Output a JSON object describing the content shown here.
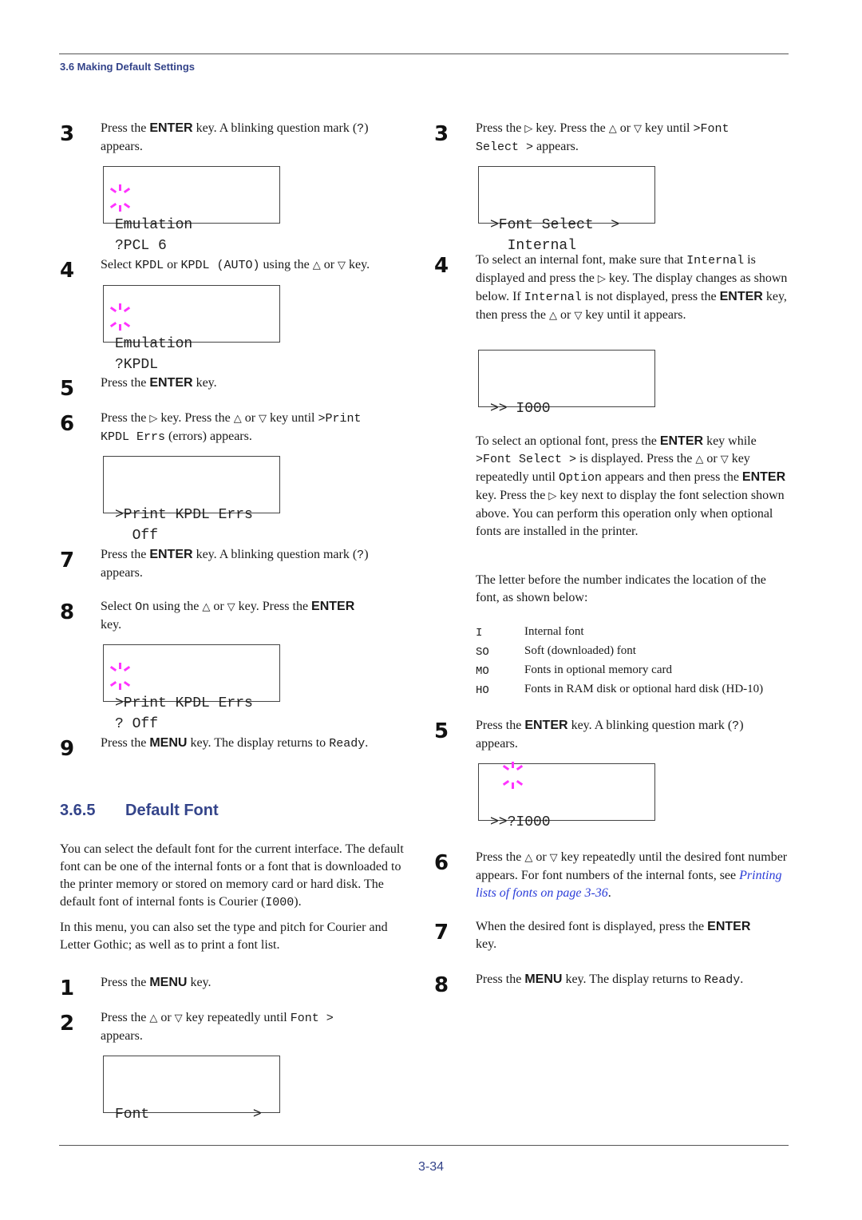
{
  "header": {
    "section_title": "3.6 Making Default Settings"
  },
  "footer": {
    "page_number": "3-34"
  },
  "left_column": {
    "steps_top": [
      {
        "number": "3",
        "parts": [
          "Press the ",
          "ENTER",
          " key. A blinking question mark (",
          "?",
          ")",
          " appears."
        ]
      },
      {
        "number": "4",
        "parts": [
          "Select ",
          "KPDL",
          " or ",
          "KPDL (AUTO)",
          " using the ",
          "△",
          " or ",
          "▽",
          " key."
        ]
      },
      {
        "number": "5",
        "parts": [
          "Press the ",
          "ENTER",
          " key."
        ]
      },
      {
        "number": "6",
        "parts": [
          "Press the ",
          "▷",
          " key. Press the ",
          "△",
          " or ",
          "▽",
          " key until ",
          ">Print",
          "KPDL Errs",
          " (errors) appears."
        ]
      },
      {
        "number": "7",
        "parts": [
          "Press the ",
          "ENTER",
          " key. A blinking question mark (",
          "?",
          ")",
          " appears."
        ]
      },
      {
        "number": "8",
        "parts": [
          "Select ",
          "On",
          " using the ",
          "△",
          " or ",
          "▽",
          " key. Press the ",
          "ENTER",
          " key."
        ]
      },
      {
        "number": "9",
        "parts": [
          "Press the ",
          "MENU",
          " key. The display returns to ",
          "Ready",
          "."
        ]
      }
    ],
    "displays": [
      {
        "line1": "Emulation",
        "line2": "?PCL 6",
        "blinking": true
      },
      {
        "line1": "Emulation",
        "line2": "?KPDL",
        "blinking": true
      },
      {
        "line1": ">Print KPDL Errs",
        "line2": "  Off",
        "blinking": false
      },
      {
        "line1": ">Print KPDL Errs",
        "line2": "? Off",
        "blinking": true
      }
    ],
    "section": {
      "number": "3.6.5",
      "title": "Default Font",
      "intro_1": [
        "You can select the default font for the current interface. The default font can be one of the internal fonts or a font that is downloaded to the printer memory or stored on memory card or hard disk. The default font of internal fonts is Courier (",
        "I000",
        ")."
      ],
      "intro_2": "In this menu, you can also set the type and pitch for Courier and Letter Gothic; as well as to print a font list.",
      "steps": [
        {
          "number": "1",
          "parts": [
            "Press the ",
            "MENU",
            " key."
          ]
        },
        {
          "number": "2",
          "parts": [
            "Press the ",
            "△",
            " or ",
            "▽",
            " key repeatedly until ",
            "Font >",
            " appears."
          ]
        }
      ],
      "display": {
        "line1": "Font            >",
        "line2": ""
      }
    }
  },
  "right_column": {
    "steps": [
      {
        "number": "3",
        "parts": [
          "Press the ",
          "▷",
          " key. Press the ",
          "△",
          " or ",
          "▽",
          " key until ",
          ">Font",
          "Select >",
          " appears."
        ]
      },
      {
        "number": "4",
        "parts": [
          "To select an internal font, make sure that ",
          "Internal",
          " is displayed and press the ",
          "▷",
          " key. The display changes as shown below. If ",
          "Internal",
          " is not displayed, press the ",
          "ENTER",
          " key, then press the ",
          "△",
          " or ",
          "▽",
          " key until it appears."
        ]
      },
      {
        "number": "5",
        "parts": [
          "Press the ",
          "ENTER",
          " key. A blinking question mark (",
          "?",
          ")",
          " appears."
        ]
      },
      {
        "number": "6",
        "parts": [
          "Press the ",
          "△",
          " or ",
          "▽",
          " key repeatedly until the desired font number appears. For font numbers of the internal fonts, see ",
          "Printing lists of fonts on page 3-36",
          "."
        ]
      },
      {
        "number": "7",
        "parts": [
          "When the desired font is displayed, press the ",
          "ENTER",
          " key."
        ]
      },
      {
        "number": "8",
        "parts": [
          "Press the ",
          "MENU",
          " key. The display returns to ",
          "Ready",
          "."
        ]
      }
    ],
    "displays": [
      {
        "line1": ">Font Select  >",
        "line2": "  Internal",
        "blinking": false
      },
      {
        "line1": ">> I000",
        "line2": "",
        "blinking": false
      },
      {
        "line1": ">>?I000",
        "line2": "",
        "blinking": true
      }
    ],
    "optional_para": [
      "To select an optional font, press the ",
      "ENTER",
      " key while ",
      ">Font Select >",
      " is displayed. Press the ",
      "△",
      " or ",
      "▽",
      " key repeatedly until ",
      "Option",
      " appears and then press the ",
      "ENTER",
      " key. Press the ",
      "▷",
      " key next to display the font selection shown above. You can perform this operation only when optional fonts are installed in the printer."
    ],
    "location_para": "The letter before the number indicates the location of the font, as shown below:",
    "font_locations": [
      {
        "code": "I",
        "description": "Internal font"
      },
      {
        "code": "SO",
        "description": "Soft (downloaded) font"
      },
      {
        "code": "MO",
        "description": "Fonts in optional memory card"
      },
      {
        "code": "HO",
        "description": "Fonts in RAM disk or optional hard disk (HD-10)"
      }
    ]
  },
  "colors": {
    "heading": "#34448a",
    "link": "#2a3cd8",
    "blink": "#ff33ff"
  }
}
